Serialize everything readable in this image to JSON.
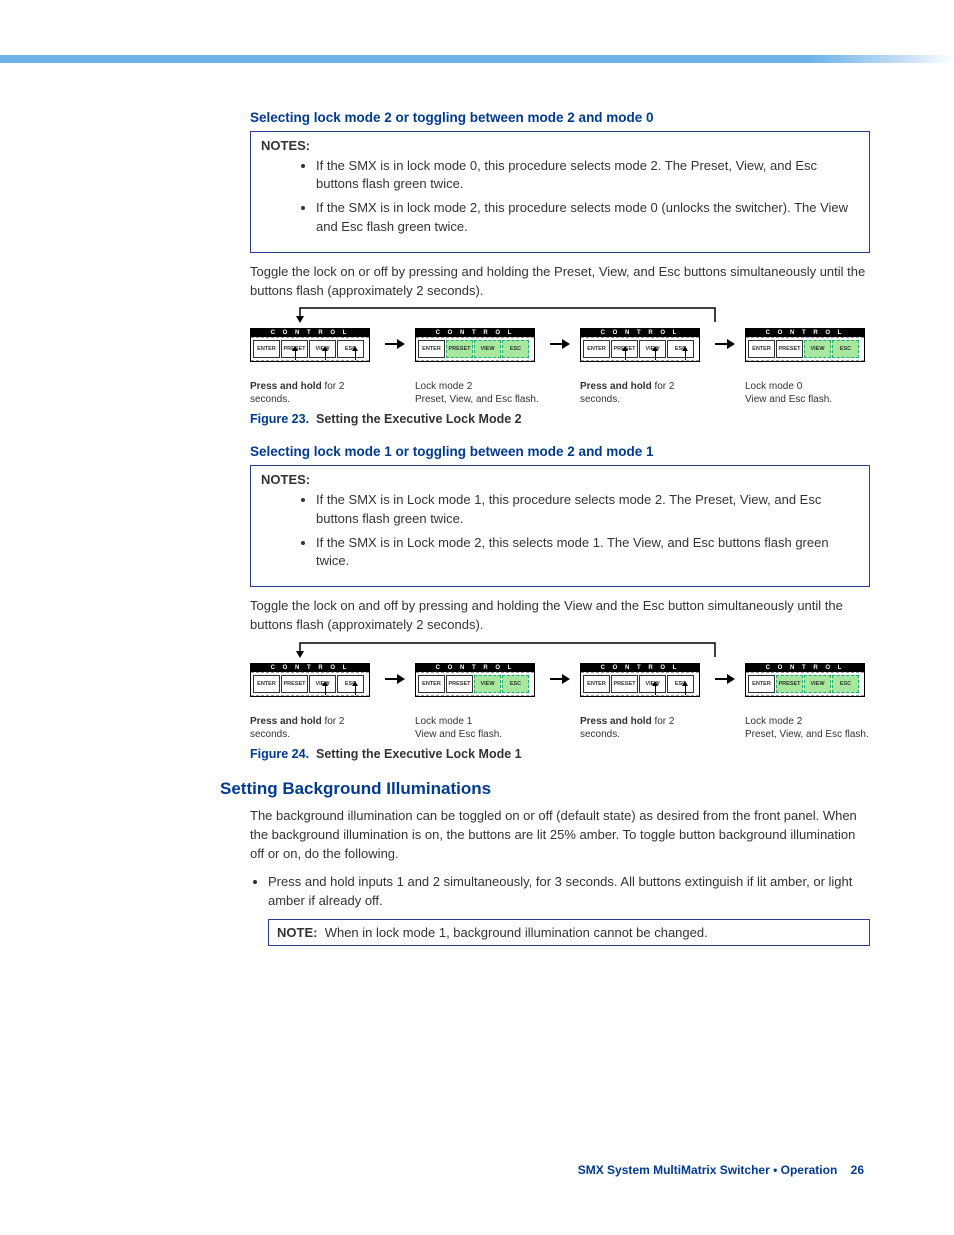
{
  "section1": {
    "heading": "Selecting lock mode 2 or toggling between mode 2 and mode 0",
    "notes_label": "NOTES:",
    "notes": [
      "If the SMX is in lock mode 0, this procedure selects mode 2. The Preset, View, and Esc buttons flash green twice.",
      "If the SMX is in lock mode 2, this procedure selects mode 0 (unlocks the switcher). The View and Esc flash green twice."
    ],
    "paragraph": "Toggle the lock on or off by pressing and holding the Preset, View, and Esc buttons simultaneously until the buttons flash (approximately 2 seconds).",
    "figure": {
      "num": "Figure 23.",
      "title": "Setting the Executive Lock Mode 2"
    },
    "diagram": {
      "control_label": "C O N T R O L",
      "buttons": [
        "ENTER",
        "PRESET",
        "VIEW",
        "ESC"
      ],
      "steps": [
        {
          "lit": [],
          "arrows": [
            1,
            2,
            3
          ],
          "bold": "Press and hold",
          "rest": " for 2 seconds."
        },
        {
          "lit": [
            1,
            2,
            3
          ],
          "arrows": [],
          "bold": "",
          "rest": "Lock mode 2\nPreset, View, and Esc flash."
        },
        {
          "lit": [],
          "arrows": [
            1,
            2,
            3
          ],
          "bold": "Press and hold",
          "rest": " for 2 seconds."
        },
        {
          "lit": [
            2,
            3
          ],
          "arrows": [],
          "bold": "",
          "rest": "Lock mode 0\nView and Esc flash."
        }
      ]
    }
  },
  "section2": {
    "heading": "Selecting lock mode 1 or toggling between mode 2 and mode 1",
    "notes_label": "NOTES:",
    "notes": [
      "If the SMX is in Lock mode 1, this procedure selects mode 2. The Preset, View, and Esc buttons flash green twice.",
      "If the SMX is in Lock mode 2, this selects mode 1. The View, and Esc buttons flash green twice."
    ],
    "paragraph": "Toggle the lock on and off by pressing and holding the View and the Esc button simultaneously until the buttons flash (approximately 2 seconds).",
    "figure": {
      "num": "Figure 24.",
      "title": "Setting the Executive Lock Mode 1"
    },
    "diagram": {
      "control_label": "C O N T R O L",
      "buttons": [
        "ENTER",
        "PRESET",
        "VIEW",
        "ESC"
      ],
      "steps": [
        {
          "lit": [],
          "arrows": [
            2,
            3
          ],
          "bold": "Press and hold",
          "rest": " for 2 seconds."
        },
        {
          "lit": [
            2,
            3
          ],
          "arrows": [],
          "bold": "",
          "rest": "Lock mode 1\nView and Esc flash."
        },
        {
          "lit": [],
          "arrows": [
            2,
            3
          ],
          "bold": "Press and hold",
          "rest": " for 2 seconds."
        },
        {
          "lit": [
            1,
            2,
            3
          ],
          "arrows": [],
          "bold": "",
          "rest": "Lock mode 2\nPreset, View, and Esc flash."
        }
      ]
    }
  },
  "section3": {
    "heading": "Setting Background Illuminations",
    "paragraph": "The background illumination can be toggled on or off (default state) as desired from the front panel. When the background illumination is on, the buttons are lit 25% amber. To toggle button background illumination off or on, do the following.",
    "bullet": "Press and hold inputs 1 and 2 simultaneously, for 3 seconds. All buttons extinguish if lit amber, or light amber if already off.",
    "note_label": "NOTE:",
    "note_text": "When in lock mode 1, background illumination cannot be changed."
  },
  "footer": {
    "text": "SMX System MultiMatrix Switcher • Operation",
    "page": "26"
  }
}
